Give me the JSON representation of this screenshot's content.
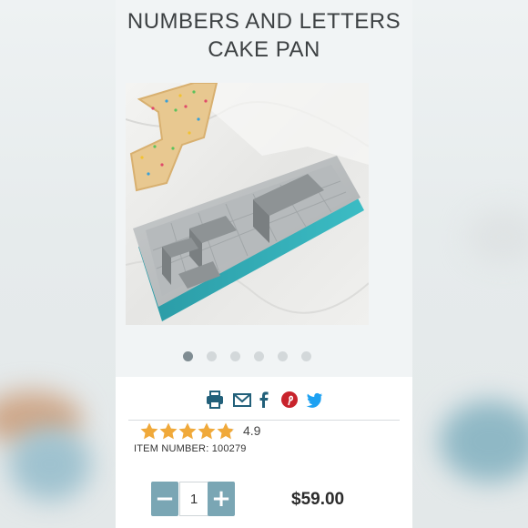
{
  "product": {
    "title_line1": "NUMBERS AND LETTERS",
    "title_line2": "CAKE PAN",
    "image_alt": "Numbers and letters cake pan with cake",
    "rating": "4.9",
    "rating_fraction": 0.98,
    "item_number": "ITEM NUMBER: 100279",
    "quantity": "1",
    "price": "$59.00"
  },
  "carousel": {
    "count": 6,
    "active_index": 0
  },
  "share": {
    "icons": [
      "print-icon",
      "email-icon",
      "facebook-icon",
      "pinterest-icon",
      "twitter-icon"
    ]
  },
  "quantity_controls": {
    "minus": "−",
    "plus": "+"
  },
  "colors": {
    "accent": "#7aa6b4",
    "star": "#f0a93a",
    "share_icon": "#22607a",
    "pinterest": "#c8232c",
    "twitter": "#1da1f2",
    "title": "#3d4143"
  }
}
